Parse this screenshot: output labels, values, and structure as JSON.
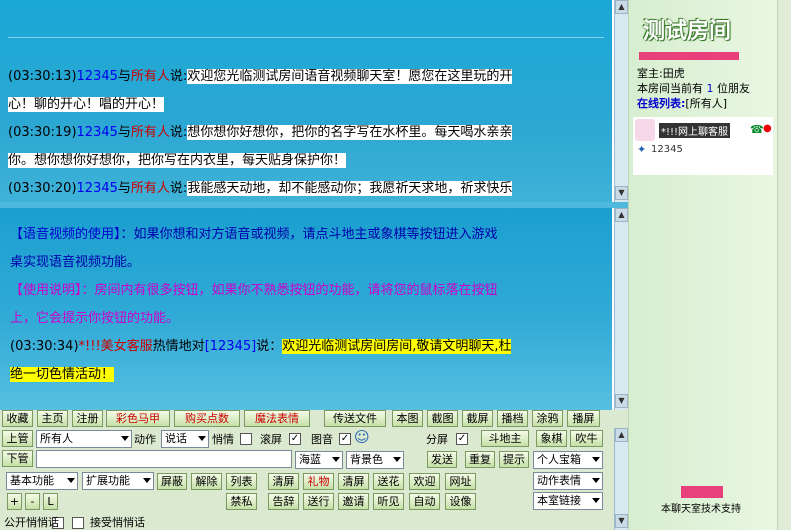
{
  "public_chat": {
    "lines": [
      {
        "time": "(03:30:13)",
        "from": "12345",
        "mid": "与",
        "to": "所有人",
        "say": "说:",
        "msg": "欢迎您光临测试房间语音视频聊天室！愿您在这里玩的开"
      },
      {
        "msg2": "心！聊的开心！唱的开心！"
      },
      {
        "time": "(03:30:19)",
        "from": "12345",
        "mid": "与",
        "to": "所有人",
        "say": "说:",
        "msg": "想你想你好想你，把你的名字写在水杯里。每天喝水亲亲"
      },
      {
        "msg2": "你。想你想你好想你，把你写在内衣里，每天贴身保护你！"
      },
      {
        "time": "(03:30:20)",
        "from": "12345",
        "mid": "与",
        "to": "所有人",
        "say": "说:",
        "msg": "我能感天动地，却不能感动你；我愿祈天求地，祈求快乐"
      }
    ]
  },
  "private_chat": {
    "help1_title": "【语音视频的使用】",
    "help1_text": "：如果你想和对方语音或视频，请点斗地主或象棋等按钮进入游戏",
    "help1_text2": "桌实现语音视频功能。",
    "help2_title": "【使用说明】",
    "help2_text": "：房间内有很多按钮，如果你不熟悉按钮的功能，请将您的鼠标落在按钮",
    "help2_text2": "上，它会提示你按钮的功能。",
    "welcome_time": "(03:30:34)",
    "welcome_from": "*!!!美女客服",
    "welcome_mid": "热情地对",
    "welcome_to": "[12345]",
    "welcome_say": "说：",
    "welcome_msg": "欢迎光临测试房间房间,敬请文明聊天,杜",
    "welcome_msg2": "绝一切色情活动！"
  },
  "toolbar_row1": [
    "收藏",
    "主页",
    "注册",
    "彩色马甲",
    "购买点数",
    "魔法表情",
    "传送文件",
    "本图",
    "截图",
    "截屏",
    "播档",
    "涂鸦",
    "播屏"
  ],
  "toolbar_row2": {
    "shangguan": "上管",
    "target": "所有人",
    "action_label": "动作",
    "action": "说话",
    "qiaoqing": "悄情",
    "gunping": "滚屏",
    "tuyin": "图音",
    "smile": "☺",
    "fenping": "分屏",
    "doudizhu": "斗地主",
    "xiangqi": "象棋",
    "chuiniu": "吹牛"
  },
  "toolbar_row3": {
    "xiaguan": "下管",
    "color": "海蓝",
    "bg": "背景色",
    "send": "发送",
    "repeat": "重复",
    "tip": "提示",
    "baoxiang": "个人宝箱"
  },
  "toolbar_row4": {
    "basic": "基本功能",
    "ext": "扩展功能",
    "buttons": [
      "屏蔽",
      "解除",
      "列表",
      "清屏",
      "礼物",
      "清屏",
      "送花",
      "欢迎",
      "网址"
    ],
    "action_emote": "动作表情"
  },
  "toolbar_row5": {
    "small": [
      "+",
      "-",
      "L"
    ],
    "buttons": [
      "禁私",
      "告辞",
      "送行",
      "邀请",
      "听见",
      "自动",
      "设像"
    ],
    "link": "本室链接"
  },
  "footer": {
    "public_whisper": "公开悄悄话",
    "accept_whisper": "接受悄悄话"
  },
  "right_panel": {
    "title": "测试房间",
    "owner": "室主:田虎",
    "count_line": "本房间当前有",
    "count": "1",
    "count_suffix": "位朋友",
    "online_label": "在线列表:",
    "online_target": "[所有人]",
    "users": [
      {
        "name": "*!!!网上聊客服"
      },
      {
        "name": "12345"
      }
    ],
    "support": "本聊天室技术支持"
  }
}
